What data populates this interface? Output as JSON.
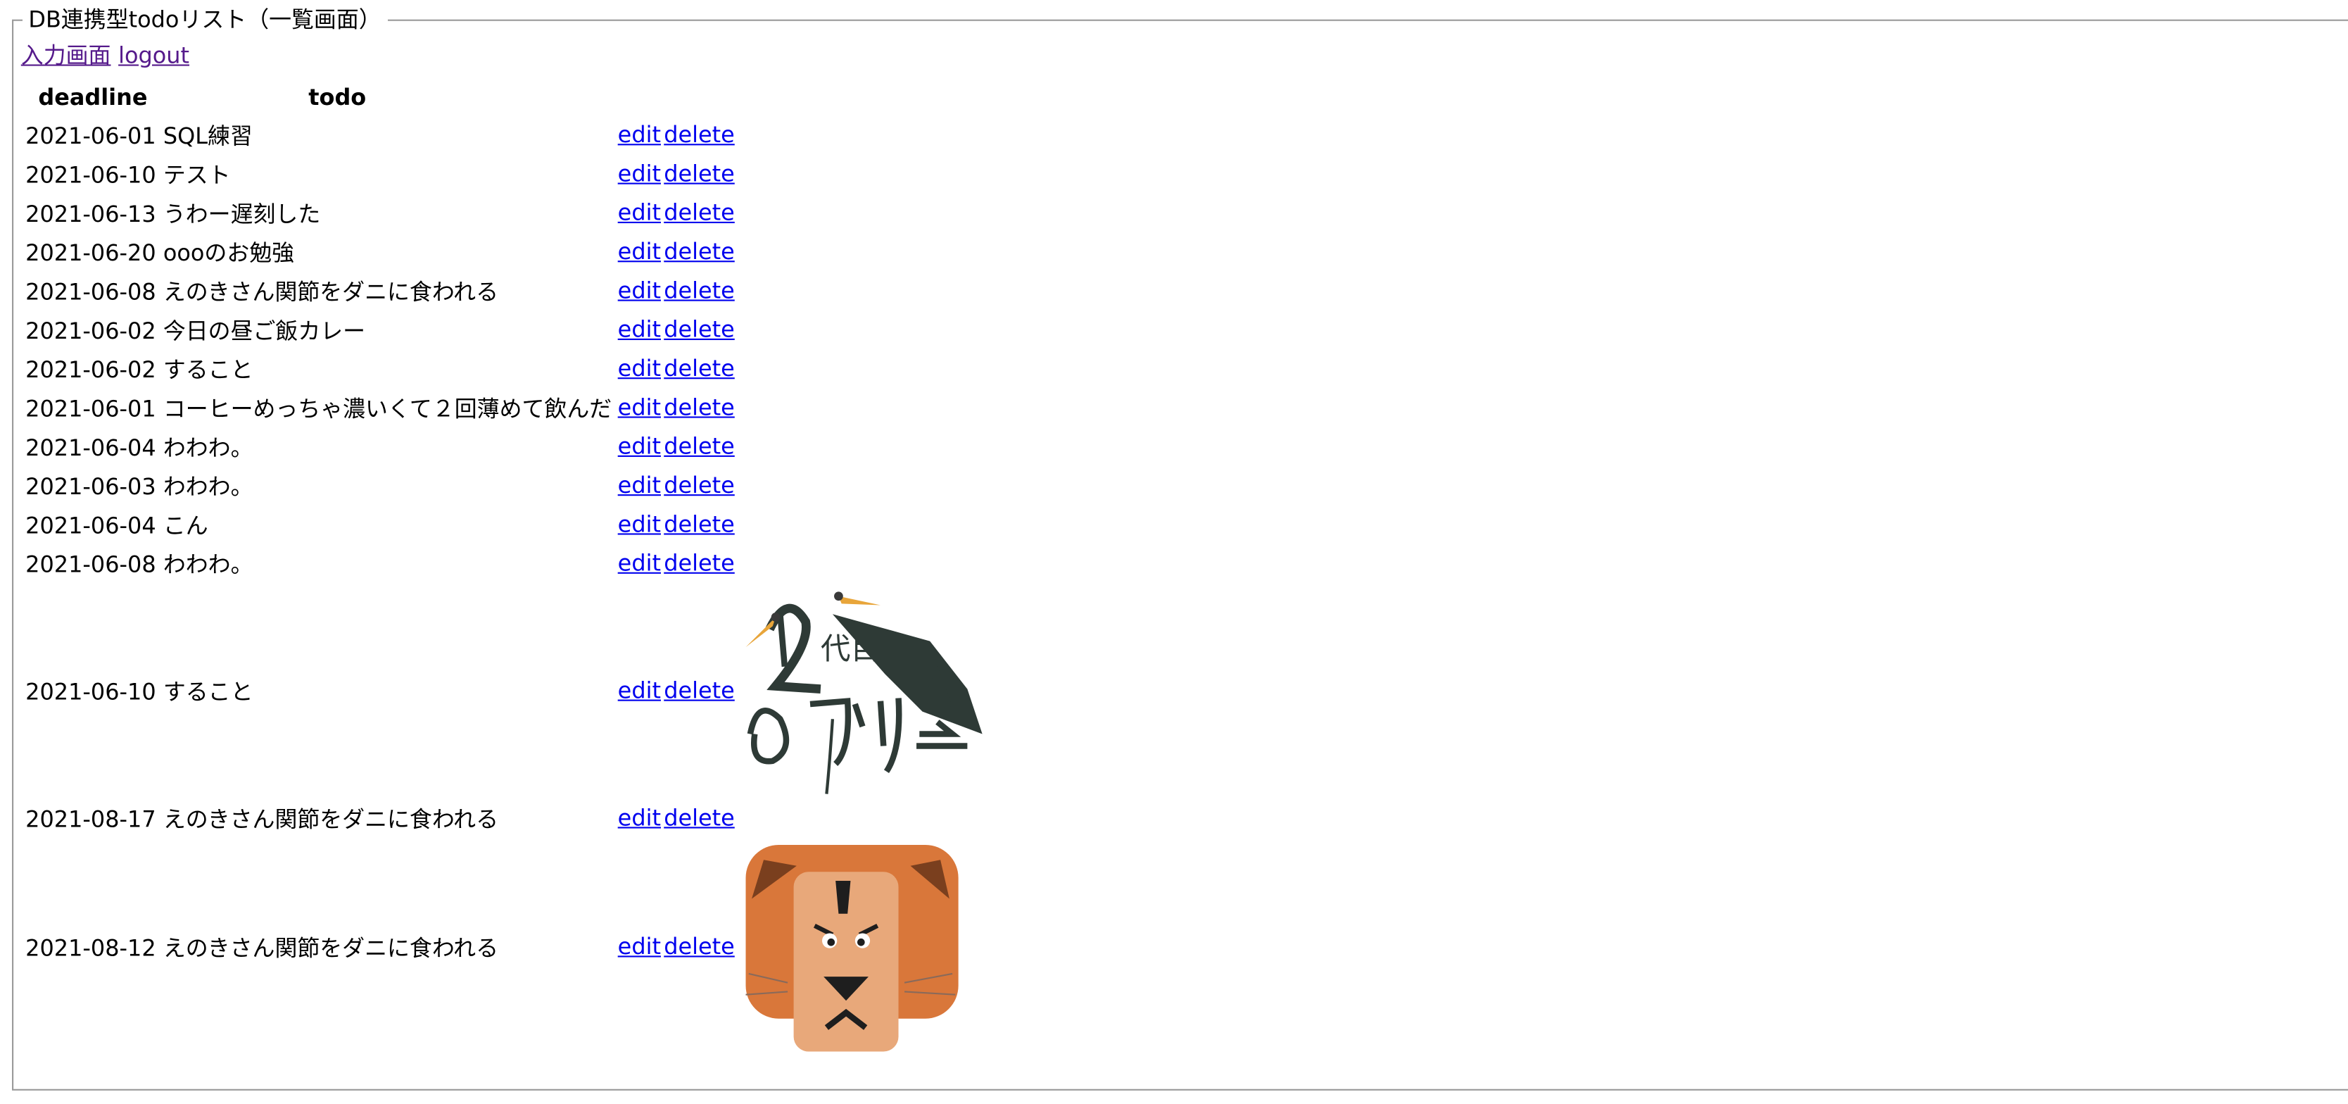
{
  "legend": "DB連携型todoリスト（一覧画面）",
  "nav": {
    "input_link": "入力画面",
    "logout_link": "logout"
  },
  "table": {
    "headers": {
      "deadline": "deadline",
      "todo": "todo"
    },
    "action_labels": {
      "edit": "edit",
      "delete": "delete"
    },
    "rows": [
      {
        "deadline": "2021-06-01",
        "todo": "SQL練習"
      },
      {
        "deadline": "2021-06-10",
        "todo": "テスト"
      },
      {
        "deadline": "2021-06-13",
        "todo": "うわー遅刻した"
      },
      {
        "deadline": "2021-06-20",
        "todo": "oooのお勉強"
      },
      {
        "deadline": "2021-06-08",
        "todo": "えのきさん関節をダニに食われる"
      },
      {
        "deadline": "2021-06-02",
        "todo": "今日の昼ご飯カレー"
      },
      {
        "deadline": "2021-06-02",
        "todo": "すること"
      },
      {
        "deadline": "2021-06-01",
        "todo": "コーヒーめっちゃ濃いくて２回薄めて飲んだ"
      },
      {
        "deadline": "2021-06-04",
        "todo": "わわわ。"
      },
      {
        "deadline": "2021-06-03",
        "todo": "わわわ。"
      },
      {
        "deadline": "2021-06-04",
        "todo": "こん"
      },
      {
        "deadline": "2021-06-08",
        "todo": "わわわ。"
      },
      {
        "deadline": "2021-06-10",
        "todo": "すること",
        "image": "crane-logo",
        "image_text": "2代目ひかり会"
      },
      {
        "deadline": "2021-08-17",
        "todo": "えのきさん関節をダニに食われる"
      },
      {
        "deadline": "2021-08-12",
        "todo": "えのきさん関節をダニに食われる",
        "image": "lion-face"
      }
    ]
  },
  "colors": {
    "link": "#0000ee",
    "visited_link": "#551a8b",
    "fieldset_border": "#9a9a9a",
    "lion_mane": "#d9773a",
    "lion_face": "#e8a87a"
  }
}
